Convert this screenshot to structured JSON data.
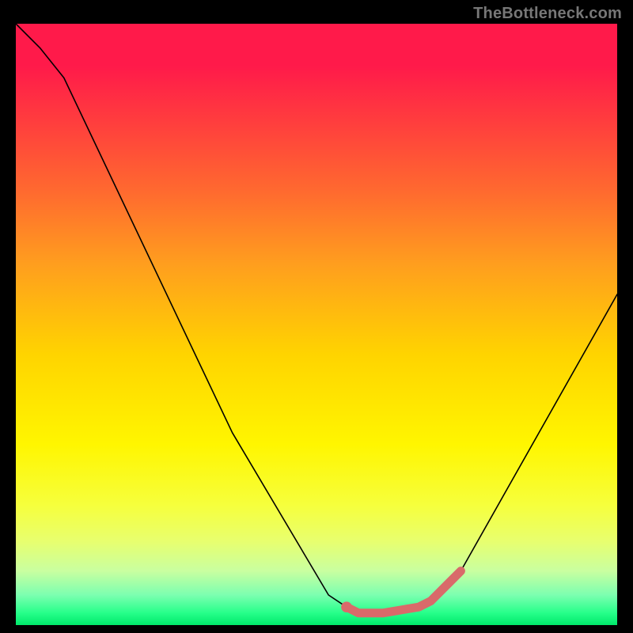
{
  "watermark": "TheBottleneck.com",
  "chart_data": {
    "type": "line",
    "title": "",
    "xlabel": "",
    "ylabel": "",
    "xlim": [
      0,
      100
    ],
    "ylim": [
      0,
      100
    ],
    "series": [
      {
        "name": "bottleneck-curve",
        "x": [
          0,
          4,
          8,
          36,
          52,
          55,
          57,
          61,
          67,
          69,
          72,
          74,
          100
        ],
        "values": [
          100,
          96,
          91,
          32,
          5,
          3,
          2,
          2,
          3,
          4,
          7,
          9,
          55
        ]
      }
    ],
    "highlight": {
      "name": "optimal-range",
      "x": [
        55,
        57,
        61,
        67,
        69,
        72,
        74
      ],
      "values": [
        3,
        2,
        2,
        3,
        4,
        7,
        9
      ]
    },
    "gradient_stops": [
      {
        "pos": 0,
        "color": "#ff1a4a"
      },
      {
        "pos": 7,
        "color": "#ff1a4a"
      },
      {
        "pos": 16,
        "color": "#ff3c3e"
      },
      {
        "pos": 28,
        "color": "#ff6a2f"
      },
      {
        "pos": 40,
        "color": "#ff9e1e"
      },
      {
        "pos": 55,
        "color": "#ffd400"
      },
      {
        "pos": 70,
        "color": "#fff600"
      },
      {
        "pos": 80,
        "color": "#f6ff3c"
      },
      {
        "pos": 86,
        "color": "#e8ff6e"
      },
      {
        "pos": 91,
        "color": "#c9ffa0"
      },
      {
        "pos": 95,
        "color": "#7cffb0"
      },
      {
        "pos": 98,
        "color": "#26ff8a"
      },
      {
        "pos": 100,
        "color": "#00e86a"
      }
    ],
    "colors": {
      "curve": "#000000",
      "highlight": "#d96a6a",
      "background": "#000000"
    }
  }
}
